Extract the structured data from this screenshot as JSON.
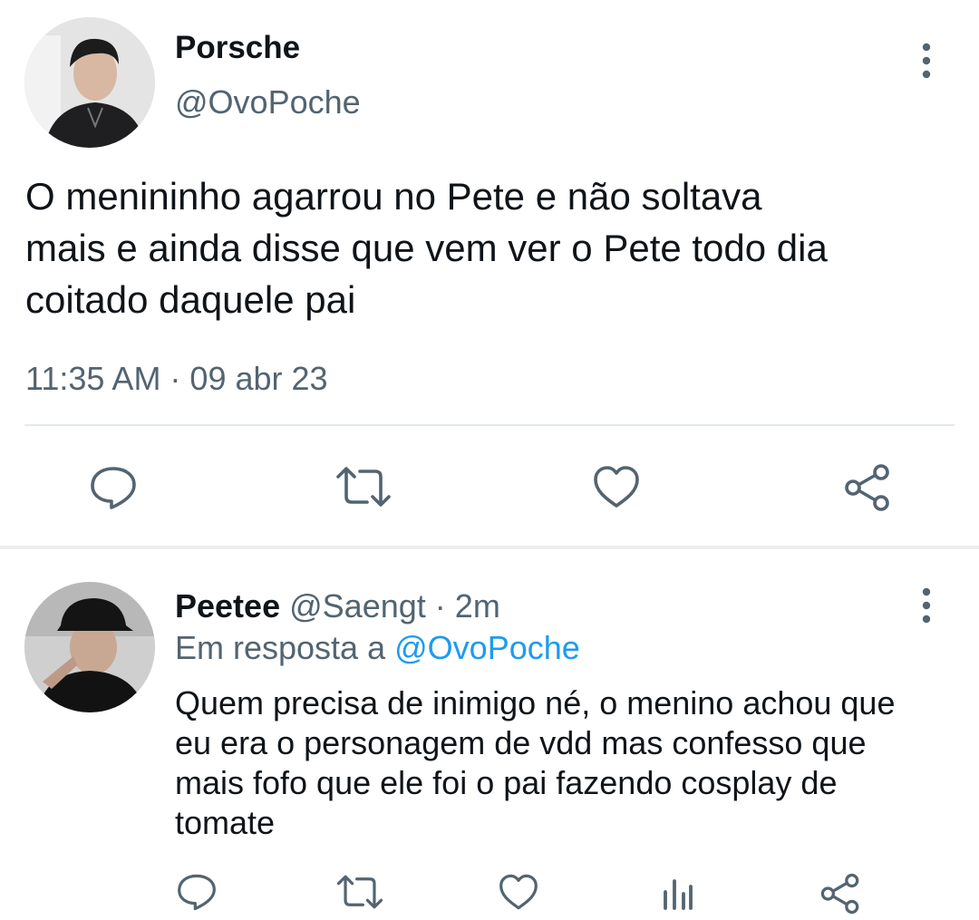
{
  "main_tweet": {
    "author_name": "Porsche",
    "author_handle": "@OvoPoche",
    "text_lines": [
      "O menininho agarrou no Pete e não soltava",
      "mais e ainda disse que vem ver o Pete todo dia",
      "coitado daquele pai"
    ],
    "timestamp": "11:35 AM · 09 abr 23",
    "actions": [
      "reply-icon",
      "retweet-icon",
      "like-icon",
      "share-icon"
    ]
  },
  "reply": {
    "author_name": "Peetee",
    "author_handle": "@Saengt",
    "separator": "·",
    "age": "2m",
    "replying_prefix": "Em resposta a",
    "replying_to": "@OvoPoche",
    "text_lines": [
      "Quem precisa de inimigo né, o menino achou que",
      "eu era o personagem de vdd mas confesso que",
      "mais fofo que ele foi o pai fazendo cosplay de",
      "tomate"
    ],
    "actions": [
      "reply-icon",
      "retweet-icon",
      "like-icon",
      "analytics-icon",
      "share-icon"
    ]
  },
  "colors": {
    "text": "#0f1419",
    "muted": "#536471",
    "link": "#1d9bf0",
    "divider": "#e6e9eb"
  }
}
